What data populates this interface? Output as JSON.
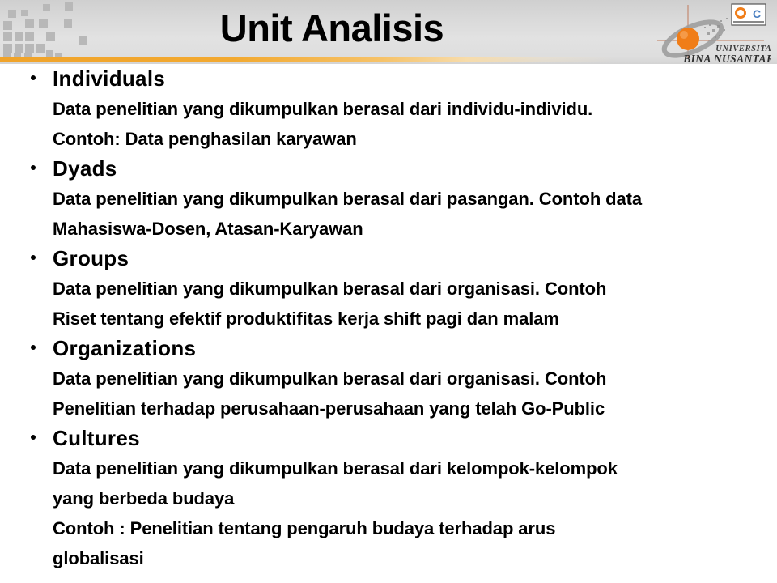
{
  "slide": {
    "title": "Unit Analisis",
    "accent_color": "#f0a32a",
    "header_bg": "#dcdcdc",
    "text_color": "#000000"
  },
  "logo": {
    "line1": "UNIVERSITAS",
    "line2": "BINA NUSANTARA",
    "sphere_color": "#f07d18",
    "orbit_color": "#9a9a9a",
    "badge_label": "certification-badge"
  },
  "bullets": [
    {
      "heading": "Individuals",
      "lines": [
        "Data penelitian yang dikumpulkan berasal dari individu-individu.",
        "Contoh: Data penghasilan karyawan"
      ]
    },
    {
      "heading": "Dyads",
      "lines": [
        "Data penelitian yang dikumpulkan berasal dari pasangan. Contoh data",
        "Mahasiswa-Dosen, Atasan-Karyawan"
      ]
    },
    {
      "heading": "Groups",
      "lines": [
        "Data penelitian yang dikumpulkan berasal dari organisasi. Contoh",
        "Riset tentang efektif produktifitas kerja shift pagi dan malam"
      ]
    },
    {
      "heading": "Organizations",
      "lines": [
        "Data penelitian yang dikumpulkan berasal dari organisasi. Contoh",
        "Penelitian terhadap perusahaan-perusahaan yang telah Go-Public"
      ]
    },
    {
      "heading": "Cultures",
      "lines": [
        "Data penelitian yang dikumpulkan berasal dari kelompok-kelompok",
        "yang berbeda budaya",
        "Contoh : Penelitian tentang pengaruh budaya terhadap arus",
        "globalisasi"
      ]
    }
  ]
}
